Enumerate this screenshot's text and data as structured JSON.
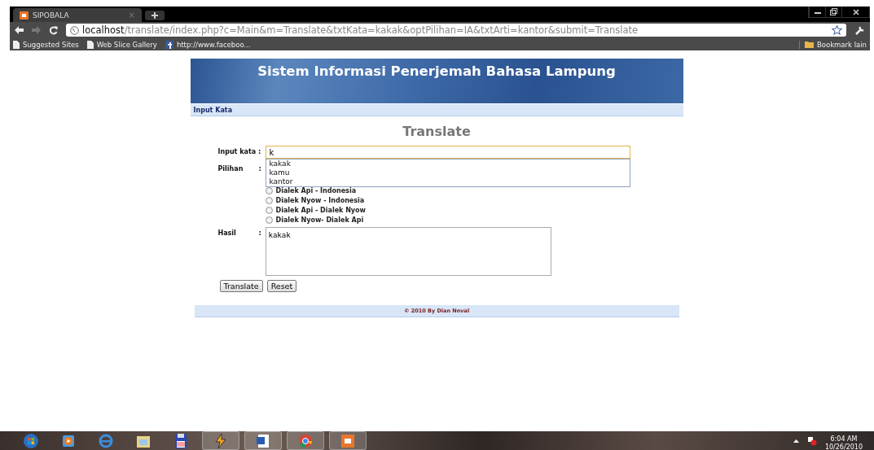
{
  "browser": {
    "tab": {
      "title": "SIPOBALA",
      "close": "×",
      "selected": true
    },
    "url": "**localhost**/translate/index.php?c=Main&m=Translate&txtKata=kakak&optPilihan=IA&txtArti=kantor&submit=Translate",
    "bookmarks": [
      "Suggested Sites",
      "Web Slice Gallery",
      "http://www.faceboo..."
    ],
    "other_bookmarks": "Bookmark lain"
  },
  "page": {
    "banner_title": "Sistem Informasi Penerjemah Bahasa Lampung",
    "nav": [
      "Input Kata"
    ],
    "heading": "Translate",
    "input_label": "Input kata :",
    "input_value": "k",
    "suggestions": [
      "kakak",
      "kamu",
      "kantor"
    ],
    "pilihan_label": "Pilihan",
    "pilihan_colon": ":",
    "options": [
      {
        "label": "Dialek Api - Indonesia",
        "selected": false
      },
      {
        "label": "Dialek Nyow - Indonesia",
        "selected": false
      },
      {
        "label": "Dialek Api - Dialek Nyow",
        "selected": false
      },
      {
        "label": "Dialek Nyow- Dialek Api",
        "selected": false
      }
    ],
    "hasil_label": "Hasil",
    "hasil_colon": ":",
    "hasil_value": "kakak",
    "buttons": [
      "Translate",
      "Reset"
    ],
    "footer": "© 2010 By Dian Noval"
  },
  "taskbar": {
    "time": "6:04 AM",
    "date": "10/26/2010"
  }
}
